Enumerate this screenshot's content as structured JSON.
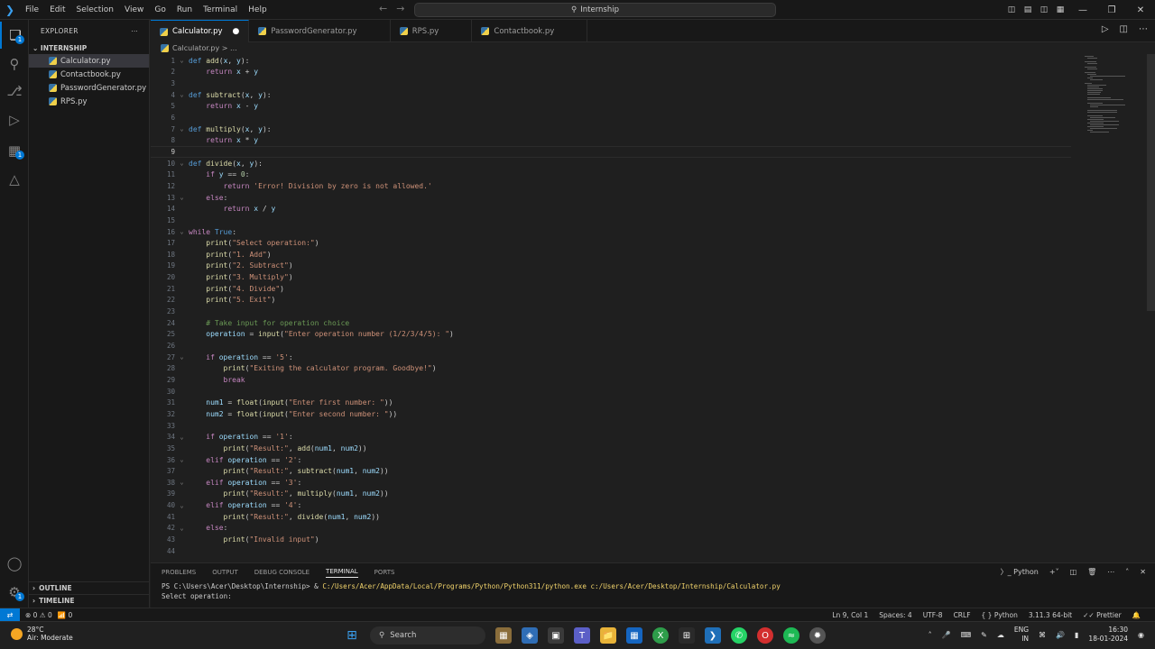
{
  "titlebar": {
    "menu": [
      "File",
      "Edit",
      "Selection",
      "View",
      "Go",
      "Run",
      "Terminal",
      "Help"
    ],
    "search_text": "Internship"
  },
  "explorer": {
    "title": "EXPLORER",
    "folder": "INTERNSHIP",
    "files": [
      "Calculator.py",
      "Contactbook.py",
      "PasswordGenerator.py",
      "RPS.py"
    ],
    "selected": "Calculator.py",
    "outline_label": "OUTLINE",
    "timeline_label": "TIMELINE"
  },
  "tabs": [
    {
      "label": "Calculator.py",
      "active": true,
      "modified": true
    },
    {
      "label": "PasswordGenerator.py",
      "active": false
    },
    {
      "label": "RPS.py",
      "active": false
    },
    {
      "label": "Contactbook.py",
      "active": false
    }
  ],
  "breadcrumb": "Calculator.py > ...",
  "editor": {
    "current_line": 9,
    "lines": [
      "def add(x, y):",
      "    return x + y",
      "",
      "def subtract(x, y):",
      "    return x - y",
      "",
      "def multiply(x, y):",
      "    return x * y",
      "",
      "def divide(x, y):",
      "    if y == 0:",
      "        return 'Error! Division by zero is not allowed.'",
      "    else:",
      "        return x / y",
      "",
      "while True:",
      "    print(\"Select operation:\")",
      "    print(\"1. Add\")",
      "    print(\"2. Subtract\")",
      "    print(\"3. Multiply\")",
      "    print(\"4. Divide\")",
      "    print(\"5. Exit\")",
      "",
      "    # Take input for operation choice",
      "    operation = input(\"Enter operation number (1/2/3/4/5): \")",
      "",
      "    if operation == '5':",
      "        print(\"Exiting the calculator program. Goodbye!\")",
      "        break",
      "",
      "    num1 = float(input(\"Enter first number: \"))",
      "    num2 = float(input(\"Enter second number: \"))",
      "",
      "    if operation == '1':",
      "        print(\"Result:\", add(num1, num2))",
      "    elif operation == '2':",
      "        print(\"Result:\", subtract(num1, num2))",
      "    elif operation == '3':",
      "        print(\"Result:\", multiply(num1, num2))",
      "    elif operation == '4':",
      "        print(\"Result:\", divide(num1, num2))",
      "    else:",
      "        print(\"Invalid input\")",
      ""
    ],
    "fold_lines": [
      1,
      4,
      7,
      10,
      13,
      16,
      27,
      34,
      36,
      38,
      40,
      42
    ]
  },
  "panel": {
    "tabs": [
      "PROBLEMS",
      "OUTPUT",
      "DEBUG CONSOLE",
      "TERMINAL",
      "PORTS"
    ],
    "active_tab": "TERMINAL",
    "shell_label": "Python",
    "terminal_prompt": "PS C:\\Users\\Acer\\Desktop\\Internship> & ",
    "terminal_command": "C:/Users/Acer/AppData/Local/Programs/Python/Python311/python.exe c:/Users/Acer/Desktop/Internship/Calculator.py",
    "terminal_output": "Select operation:"
  },
  "statusbar": {
    "errors": "0",
    "warnings": "0",
    "ports": "0",
    "position": "Ln 9, Col 1",
    "spaces": "Spaces: 4",
    "encoding": "UTF-8",
    "eol": "CRLF",
    "language": "Python",
    "interpreter": "3.11.3 64-bit",
    "formatter": "Prettier"
  },
  "taskbar": {
    "temperature": "28°C",
    "condition": "Air: Moderate",
    "search_label": "Search",
    "lang_top": "ENG",
    "lang_bottom": "IN",
    "time": "16:30",
    "date": "18-01-2024"
  }
}
